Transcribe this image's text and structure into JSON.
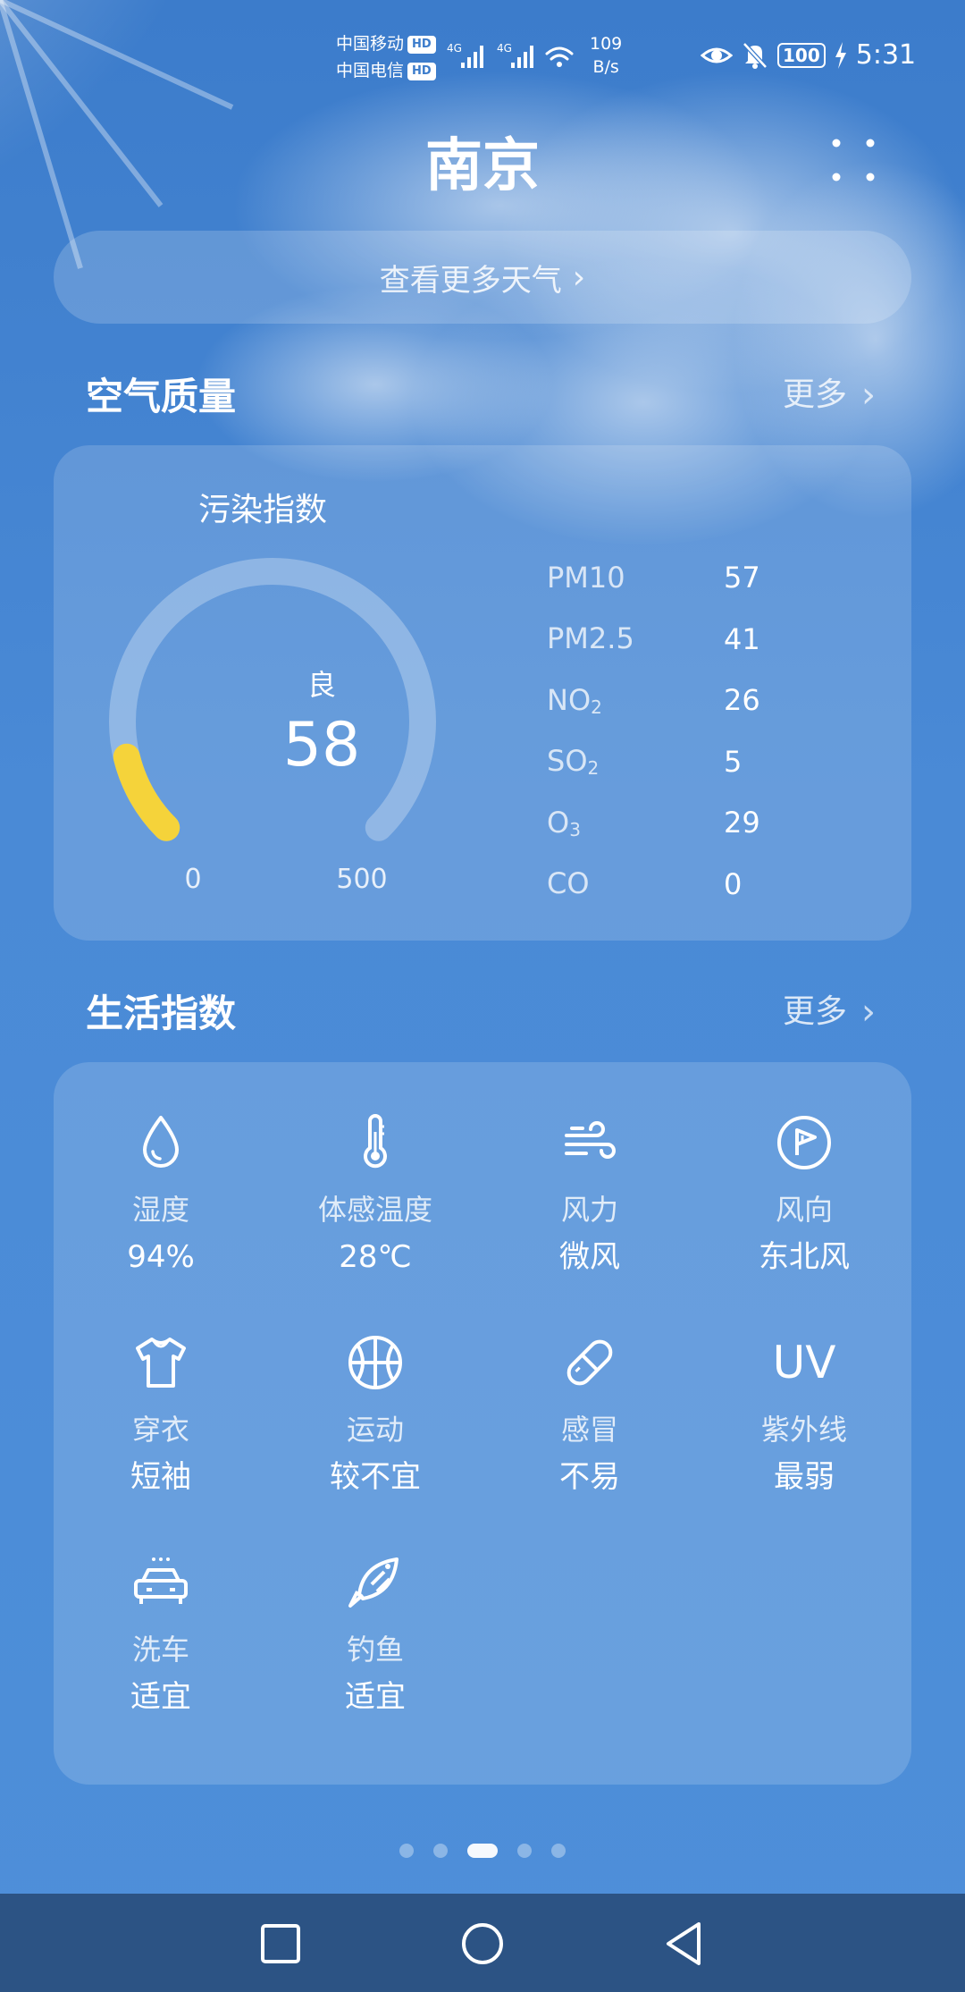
{
  "status_bar": {
    "carrier1": "中国移动",
    "carrier2": "中国电信",
    "hd": "HD",
    "net_type1": "4G",
    "net_type2": "4G",
    "net_speed_value": "109",
    "net_speed_unit": "B/s",
    "battery": "100",
    "time": "5:31"
  },
  "header": {
    "city": "南京",
    "more_weather": "查看更多天气"
  },
  "air_quality": {
    "title": "空气质量",
    "more": "更多",
    "index_label": "污染指数",
    "level": "良",
    "value": "58",
    "scale_min": "0",
    "scale_max": "500",
    "gauge_fraction": 0.116,
    "gauge_color": "#f5d33a",
    "pollutants": [
      {
        "name": "PM10",
        "sub": "",
        "value": "57"
      },
      {
        "name": "PM2.5",
        "sub": "",
        "value": "41"
      },
      {
        "name": "NO",
        "sub": "2",
        "value": "26"
      },
      {
        "name": "SO",
        "sub": "2",
        "value": "5"
      },
      {
        "name": "O",
        "sub": "3",
        "value": "29"
      },
      {
        "name": "CO",
        "sub": "",
        "value": "0"
      }
    ]
  },
  "life_index": {
    "title": "生活指数",
    "more": "更多",
    "items": [
      {
        "icon": "humidity-icon",
        "label": "湿度",
        "value": "94%"
      },
      {
        "icon": "thermometer-icon",
        "label": "体感温度",
        "value": "28℃"
      },
      {
        "icon": "wind-icon",
        "label": "风力",
        "value": "微风"
      },
      {
        "icon": "wind-direction-icon",
        "label": "风向",
        "value": "东北风"
      },
      {
        "icon": "clothing-icon",
        "label": "穿衣",
        "value": "短袖"
      },
      {
        "icon": "sport-icon",
        "label": "运动",
        "value": "较不宜"
      },
      {
        "icon": "pill-icon",
        "label": "感冒",
        "value": "不易"
      },
      {
        "icon": "uv-icon",
        "uv_text": "UV",
        "label": "紫外线",
        "value": "最弱"
      },
      {
        "icon": "car-wash-icon",
        "label": "洗车",
        "value": "适宜"
      },
      {
        "icon": "fishing-icon",
        "label": "钓鱼",
        "value": "适宜"
      }
    ]
  },
  "pager": {
    "count": 5,
    "active": 3
  }
}
